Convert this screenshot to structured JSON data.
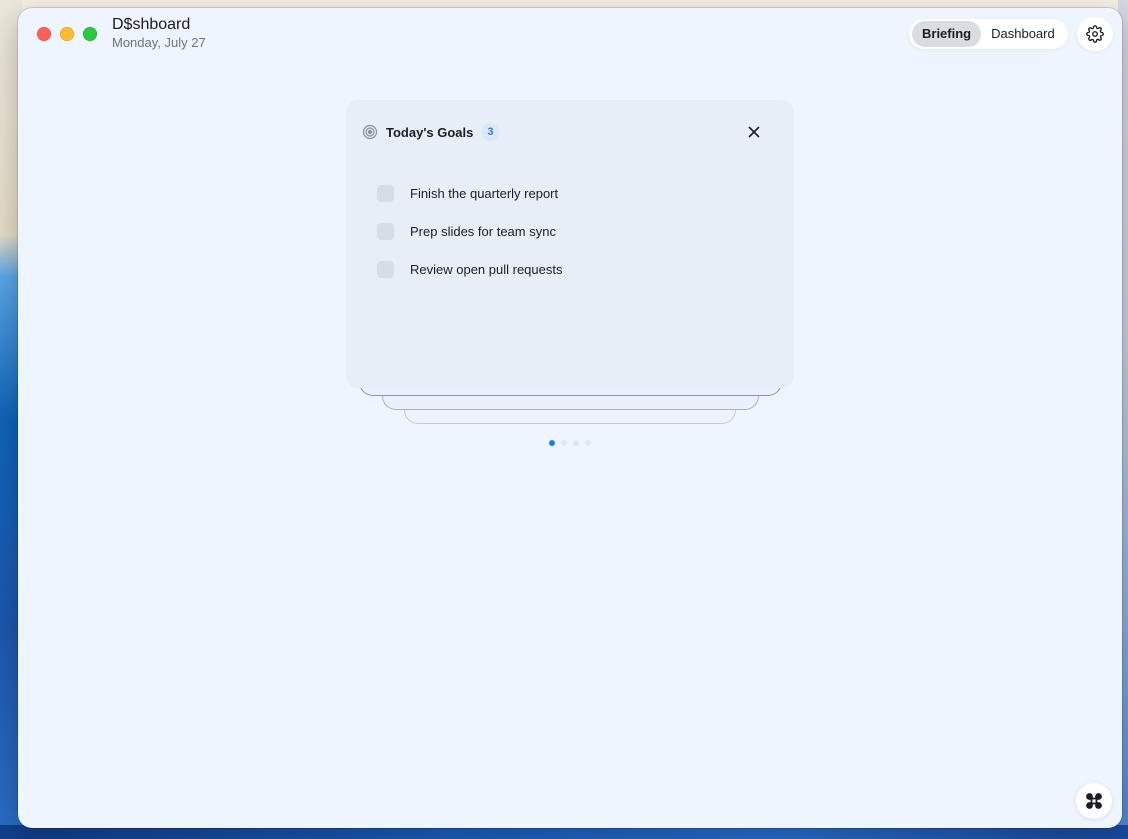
{
  "window": {
    "title": "D$shboard",
    "subtitle": "Monday, July 27"
  },
  "nav": {
    "tabs": [
      {
        "label": "Briefing",
        "active": true
      },
      {
        "label": "Dashboard",
        "active": false
      }
    ],
    "settings_icon": "gear-icon"
  },
  "goals_card": {
    "title": "Today's Goals",
    "count": "3",
    "icon": "target-icon",
    "close_icon": "close-icon",
    "items": [
      {
        "label": "Finish the quarterly report",
        "checked": false
      },
      {
        "label": "Prep slides for team sync",
        "checked": false
      },
      {
        "label": "Review open pull requests",
        "checked": false
      }
    ]
  },
  "pager": {
    "total": 4,
    "current": 1
  },
  "fab": {
    "icon": "command-icon"
  },
  "colors": {
    "accent": "#1a7ef2",
    "badge_text": "#3a7bd5",
    "window_bg": "#eef5fe"
  }
}
